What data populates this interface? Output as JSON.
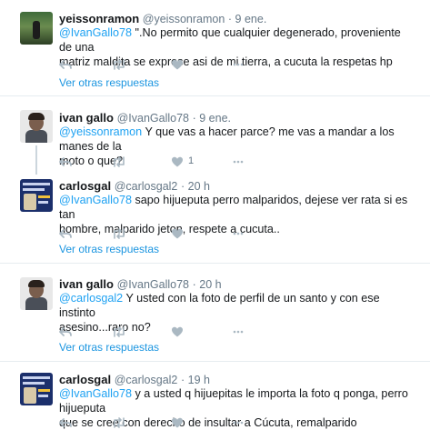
{
  "tweets": [
    {
      "name": "yeissonramon",
      "handle": "@yeissonramon",
      "time": "· 9 ene.",
      "mention": "@IvanGallo78",
      "text_after": " \".No permito que cualquier degenerado, proveniente de una",
      "line2": "matriz maldita se exprese asi de mi tierra, a cucuta la respetas hp",
      "like_count": "",
      "more_replies": "Ver otras respuestas"
    },
    {
      "name": "ivan gallo",
      "handle": "@IvanGallo78",
      "time": "· 9 ene.",
      "mention": "@yeissonramon",
      "text_after": " Y que vas a hacer parce? me vas a mandar a los manes de la",
      "line2": "moto o que?",
      "like_count": "1",
      "more_replies": ""
    },
    {
      "name": "carlosgal",
      "handle": "@carlosgal2",
      "time": "· 20 h",
      "mention": "@IvanGallo78",
      "text_after": "  sapo hijueputa perro malparidos, dejese ver rata si es tan",
      "line2": "hombre, malparido jeton, respete a cucuta..",
      "like_count": "",
      "more_replies": "Ver otras respuestas"
    },
    {
      "name": "ivan gallo",
      "handle": "@IvanGallo78",
      "time": "· 20 h",
      "mention": "@carlosgal2",
      "text_after": " Y usted con la foto de perfil de un santo y con ese instinto",
      "line2": "asesino...raro no?",
      "like_count": "",
      "more_replies": "Ver otras respuestas"
    },
    {
      "name": "carlosgal",
      "handle": "@carlosgal2",
      "time": "· 19 h",
      "mention": "@IvanGallo78",
      "text_after": " y a usted q hijuepitas le importa la foto q ponga, perro hijueputa",
      "line2": "que se cree con derecho de insultar a Cúcuta, remalparido",
      "like_count": "",
      "more_replies": ""
    }
  ],
  "icons": [
    "reply-icon",
    "retweet-icon",
    "like-icon",
    "more-icon"
  ],
  "colors": {
    "link": "#1b95e0",
    "mention": "#1da1f2",
    "meta": "#657786",
    "icon": "#aab8c2",
    "divider": "#e6ecf0"
  }
}
